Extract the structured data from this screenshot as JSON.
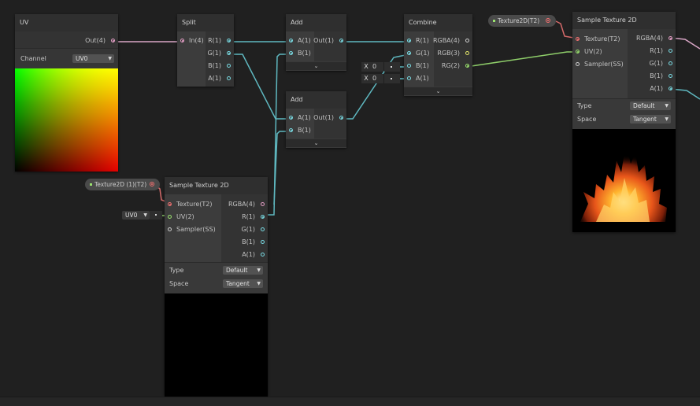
{
  "colors": {
    "background": "#202020",
    "vector1": "#79dbe3",
    "vector2": "#9be36f",
    "vector4": "#e59ec6",
    "texture": "#f07070",
    "vector3": "#e4e66a"
  },
  "uv_node": {
    "title": "UV",
    "out_label": "Out(4)",
    "channel_label": "Channel",
    "channel_value": "UV0"
  },
  "split_node": {
    "title": "Split",
    "in_label": "In(4)",
    "outputs": [
      "R(1)",
      "G(1)",
      "B(1)",
      "A(1)"
    ]
  },
  "add_node_1": {
    "title": "Add",
    "inputs": [
      "A(1)",
      "B(1)"
    ],
    "out_label": "Out(1)"
  },
  "add_node_2": {
    "title": "Add",
    "inputs": [
      "A(1)",
      "B(1)"
    ],
    "out_label": "Out(1)"
  },
  "combine_node": {
    "title": "Combine",
    "inputs": [
      "R(1)",
      "G(1)",
      "B(1)",
      "A(1)"
    ],
    "outputs": [
      "RGBA(4)",
      "RGB(3)",
      "RG(2)"
    ]
  },
  "combine_fields": [
    {
      "axis": "X",
      "value": "0"
    },
    {
      "axis": "X",
      "value": "0"
    }
  ],
  "texture_property_1": {
    "label": "Texture2D(T2)"
  },
  "texture_property_2": {
    "label": "Texture2D (1)(T2)"
  },
  "sample_node_1": {
    "title": "Sample Texture 2D",
    "inputs": [
      "Texture(T2)",
      "UV(2)",
      "Sampler(SS)"
    ],
    "outputs": [
      "RGBA(4)",
      "R(1)",
      "G(1)",
      "B(1)",
      "A(1)"
    ],
    "type_label": "Type",
    "type_value": "Default",
    "space_label": "Space",
    "space_value": "Tangent"
  },
  "sample_node_2": {
    "title": "Sample Texture 2D",
    "inputs": [
      "Texture(T2)",
      "UV(2)",
      "Sampler(SS)"
    ],
    "outputs": [
      "RGBA(4)",
      "R(1)",
      "G(1)",
      "B(1)",
      "A(1)"
    ],
    "type_label": "Type",
    "type_value": "Default",
    "space_label": "Space",
    "space_value": "Tangent",
    "uv_default": "UV0"
  }
}
